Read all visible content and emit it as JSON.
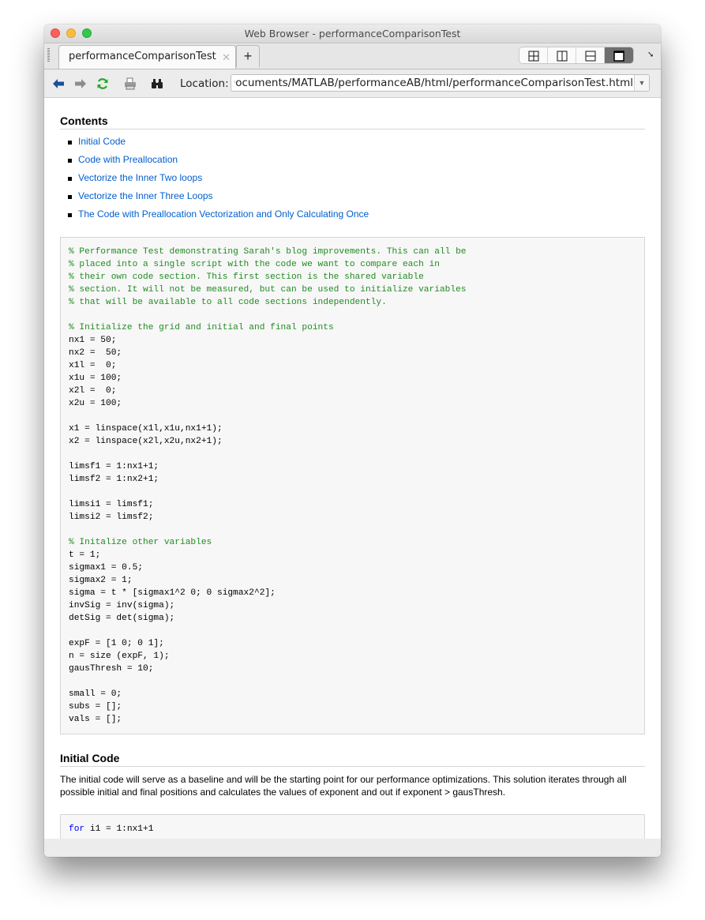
{
  "window": {
    "title": "Web Browser - performanceComparisonTest"
  },
  "tabs": [
    {
      "label": "performanceComparisonTest",
      "active": true,
      "close_icon": "close-x-icon"
    }
  ],
  "new_tab_label": "+",
  "layout_buttons": [
    {
      "name": "tile-grid",
      "icon": "grid-2x2-icon",
      "active": false
    },
    {
      "name": "tile-columns",
      "icon": "split-vertical-icon",
      "active": false
    },
    {
      "name": "tile-rows",
      "icon": "split-horizontal-icon",
      "active": false
    },
    {
      "name": "maximize",
      "icon": "single-panel-icon",
      "active": true
    }
  ],
  "toolbar": {
    "back_icon": "back-arrow-icon",
    "forward_icon": "forward-arrow-icon",
    "refresh_icon": "refresh-icon",
    "print_icon": "printer-icon",
    "find_icon": "binoculars-icon",
    "location_label": "Location:",
    "location_value": "ll/Documents/MATLAB/performanceAB/html/performanceComparisonTest.html"
  },
  "colors": {
    "link": "#005fce",
    "comment": "#228b22",
    "keyword": "#0000ff",
    "code_bg": "#f7f7f7"
  },
  "page": {
    "contents_heading": "Contents",
    "toc": [
      "Initial Code",
      "Code with Preallocation",
      "Vectorize the Inner Two loops",
      "Vectorize the Inner Three Loops",
      "The Code with Preallocation Vectorization and Only Calculating Once"
    ],
    "code_block_1": [
      {
        "text": "% Performance Test demonstrating Sarah's blog improvements. This can all be",
        "type": "comment"
      },
      {
        "text": "% placed into a single script with the code we want to compare each in",
        "type": "comment"
      },
      {
        "text": "% their own code section. This first section is the shared variable",
        "type": "comment"
      },
      {
        "text": "% section. It will not be measured, but can be used to initialize variables",
        "type": "comment"
      },
      {
        "text": "% that will be available to all code sections independently.",
        "type": "comment"
      },
      {
        "text": "",
        "type": "code"
      },
      {
        "text": "% Initialize the grid and initial and final points",
        "type": "comment"
      },
      {
        "text": "nx1 = 50;",
        "type": "code"
      },
      {
        "text": "nx2 =  50;",
        "type": "code"
      },
      {
        "text": "x1l =  0;",
        "type": "code"
      },
      {
        "text": "x1u = 100;",
        "type": "code"
      },
      {
        "text": "x2l =  0;",
        "type": "code"
      },
      {
        "text": "x2u = 100;",
        "type": "code"
      },
      {
        "text": "",
        "type": "code"
      },
      {
        "text": "x1 = linspace(x1l,x1u,nx1+1);",
        "type": "code"
      },
      {
        "text": "x2 = linspace(x2l,x2u,nx2+1);",
        "type": "code"
      },
      {
        "text": "",
        "type": "code"
      },
      {
        "text": "limsf1 = 1:nx1+1;",
        "type": "code"
      },
      {
        "text": "limsf2 = 1:nx2+1;",
        "type": "code"
      },
      {
        "text": "",
        "type": "code"
      },
      {
        "text": "limsi1 = limsf1;",
        "type": "code"
      },
      {
        "text": "limsi2 = limsf2;",
        "type": "code"
      },
      {
        "text": "",
        "type": "code"
      },
      {
        "text": "% Initalize other variables",
        "type": "comment"
      },
      {
        "text": "t = 1;",
        "type": "code"
      },
      {
        "text": "sigmax1 = 0.5;",
        "type": "code"
      },
      {
        "text": "sigmax2 = 1;",
        "type": "code"
      },
      {
        "text": "sigma = t * [sigmax1^2 0; 0 sigmax2^2];",
        "type": "code"
      },
      {
        "text": "invSig = inv(sigma);",
        "type": "code"
      },
      {
        "text": "detSig = det(sigma);",
        "type": "code"
      },
      {
        "text": "",
        "type": "code"
      },
      {
        "text": "expF = [1 0; 0 1];",
        "type": "code"
      },
      {
        "text": "n = size (expF, 1);",
        "type": "code"
      },
      {
        "text": "gausThresh = 10;",
        "type": "code"
      },
      {
        "text": "",
        "type": "code"
      },
      {
        "text": "small = 0;",
        "type": "code"
      },
      {
        "text": "subs = [];",
        "type": "code"
      },
      {
        "text": "vals = [];",
        "type": "code"
      }
    ],
    "section_initial_code": {
      "heading": "Initial Code",
      "description": "The initial code will serve as a baseline and will be the starting point for our performance optimizations. This solution iterates through all possible initial and final positions and calculates the values of exponent and out if exponent > gausThresh.",
      "code_keyword": "for",
      "code_rest": " i1 = 1:nx1+1"
    }
  }
}
